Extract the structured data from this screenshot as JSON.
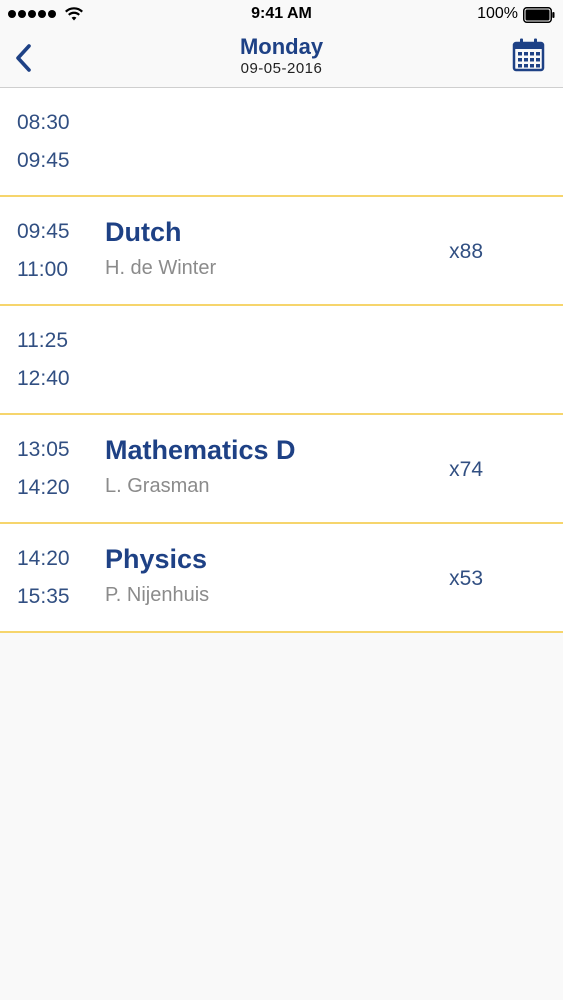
{
  "status_bar": {
    "time": "9:41 AM",
    "battery": "100%"
  },
  "header": {
    "title": "Monday",
    "date": "09-05-2016",
    "back_icon": "chevron-left-icon",
    "calendar_icon": "calendar-icon",
    "accent_color": "#1e4185"
  },
  "schedule": {
    "separator_color": "#f6d56c",
    "rows": [
      {
        "start": "08:30",
        "end": "09:45",
        "subject": "",
        "teacher": "",
        "room": ""
      },
      {
        "start": "09:45",
        "end": "11:00",
        "subject": "Dutch",
        "teacher": "H. de Winter",
        "room": "x88"
      },
      {
        "start": "11:25",
        "end": "12:40",
        "subject": "",
        "teacher": "",
        "room": ""
      },
      {
        "start": "13:05",
        "end": "14:20",
        "subject": "Mathematics D",
        "teacher": "L. Grasman",
        "room": "x74"
      },
      {
        "start": "14:20",
        "end": "15:35",
        "subject": "Physics",
        "teacher": "P. Nijenhuis",
        "room": "x53"
      }
    ]
  }
}
